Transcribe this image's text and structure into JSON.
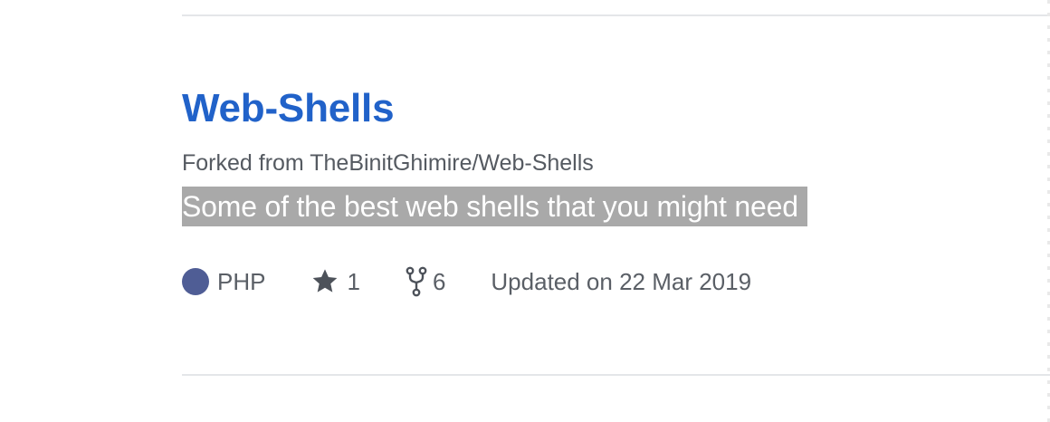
{
  "repo": {
    "name": "Web-Shells",
    "forked_prefix": "Forked from ",
    "forked_source": "TheBinitGhimire/Web-Shells",
    "description": "Some of the best web shells that you might need",
    "language": {
      "name": "PHP",
      "color": "#4f5d95"
    },
    "stars": "1",
    "forks": "6",
    "updated": "Updated on 22 Mar 2019"
  },
  "icons": {
    "star": "star-icon",
    "fork": "fork-icon"
  }
}
